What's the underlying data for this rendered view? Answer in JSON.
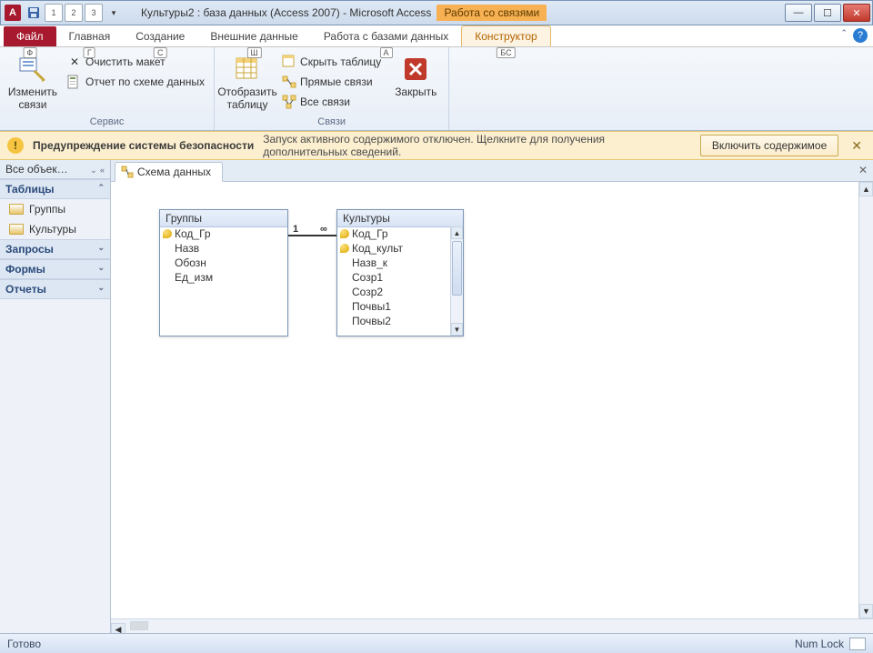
{
  "window": {
    "app_letter": "A",
    "title_main": "Культуры2 : база данных (Access 2007)  -  Microsoft Access",
    "contextual_title": "Работа со связями"
  },
  "qat": {
    "n1": "1",
    "n2": "2",
    "n3": "3"
  },
  "tabs": {
    "file": "Файл",
    "home": "Главная",
    "create": "Создание",
    "external": "Внешние данные",
    "dbtools": "Работа с базами данных",
    "design": "Конструктор",
    "kt_file": "Ф",
    "kt_home": "Г",
    "kt_create": "С",
    "kt_external": "Ш",
    "kt_dbtools": "А",
    "kt_design": "БС"
  },
  "ribbon": {
    "group_service": "Сервис",
    "group_relations": "Связи",
    "edit_relations": "Изменить связи",
    "clear_layout": "Очистить макет",
    "schema_report": "Отчет по схеме данных",
    "show_table": "Отобразить таблицу",
    "hide_table": "Скрыть таблицу",
    "direct_relations": "Прямые связи",
    "all_relations": "Все связи",
    "close": "Закрыть"
  },
  "security": {
    "title": "Предупреждение системы безопасности",
    "message": "Запуск активного содержимого отключен. Щелкните для получения дополнительных сведений.",
    "enable": "Включить содержимое"
  },
  "nav": {
    "header": "Все объек…",
    "sec_tables": "Таблицы",
    "sec_queries": "Запросы",
    "sec_forms": "Формы",
    "sec_reports": "Отчеты",
    "item_groups": "Группы",
    "item_cultures": "Культуры"
  },
  "doc": {
    "tab_schema": "Схема данных"
  },
  "schema": {
    "table_groups": "Группы",
    "table_cultures": "Культуры",
    "rel_one": "1",
    "rel_many": "∞",
    "groups_fields": [
      "Код_Гр",
      "Назв",
      "Обозн",
      "Ед_изм"
    ],
    "cultures_fields": [
      "Код_Гр",
      "Код_культ",
      "Назв_к",
      "Созр1",
      "Созр2",
      "Почвы1",
      "Почвы2"
    ]
  },
  "status": {
    "ready": "Готово",
    "numlock": "Num Lock"
  }
}
